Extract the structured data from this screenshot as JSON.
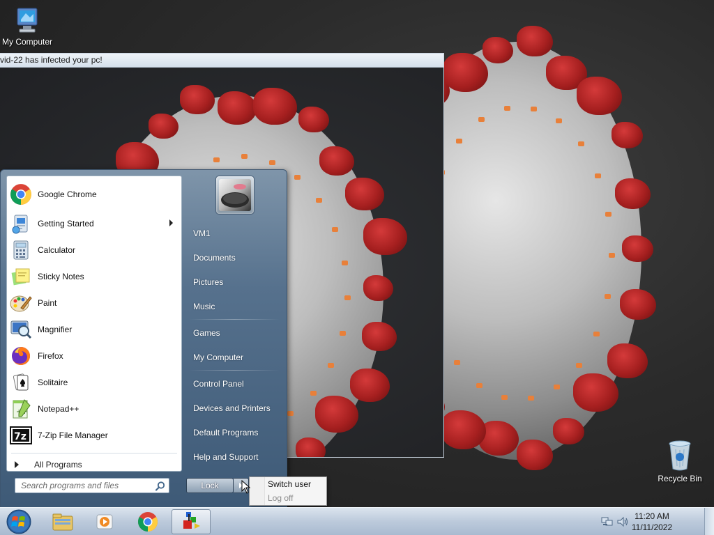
{
  "desktop": {
    "icons": [
      {
        "label": "My Computer",
        "icon": "my-computer-icon"
      },
      {
        "label": "Recycle Bin",
        "icon": "recycle-bin-icon"
      }
    ]
  },
  "window": {
    "title": "vid-22 has infected your pc!"
  },
  "start_menu": {
    "programs": [
      {
        "label": "Google Chrome",
        "icon": "chrome-icon",
        "submenu": false
      },
      {
        "label": "Getting Started",
        "icon": "getting-started-icon",
        "submenu": true
      },
      {
        "label": "Calculator",
        "icon": "calculator-icon",
        "submenu": false
      },
      {
        "label": "Sticky Notes",
        "icon": "sticky-notes-icon",
        "submenu": false
      },
      {
        "label": "Paint",
        "icon": "paint-icon",
        "submenu": false
      },
      {
        "label": "Magnifier",
        "icon": "magnifier-icon",
        "submenu": false
      },
      {
        "label": "Firefox",
        "icon": "firefox-icon",
        "submenu": false
      },
      {
        "label": "Solitaire",
        "icon": "solitaire-icon",
        "submenu": false
      },
      {
        "label": "Notepad++",
        "icon": "notepadpp-icon",
        "submenu": false
      },
      {
        "label": "7-Zip File Manager",
        "icon": "7zip-icon",
        "submenu": false
      }
    ],
    "all_programs": "All Programs",
    "search_placeholder": "Search programs and files",
    "places": [
      {
        "label": "VM1"
      },
      {
        "label": "Documents"
      },
      {
        "label": "Pictures"
      },
      {
        "label": "Music"
      },
      {
        "label": "Games"
      },
      {
        "label": "My Computer"
      },
      {
        "label": "Control Panel"
      },
      {
        "label": "Devices and Printers"
      },
      {
        "label": "Default Programs"
      },
      {
        "label": "Help and Support"
      }
    ],
    "lock_label": "Lock"
  },
  "power_menu": {
    "items": [
      {
        "label": "Switch user",
        "enabled": true
      },
      {
        "label": "Log off",
        "enabled": false
      }
    ]
  },
  "taskbar": {
    "pinned": [
      {
        "icon": "windows-explorer-icon"
      },
      {
        "icon": "media-player-icon"
      },
      {
        "icon": "chrome-icon"
      },
      {
        "icon": "running-app-icon",
        "active": true
      }
    ],
    "time": "11:20 AM",
    "date": "11/11/2022"
  }
}
